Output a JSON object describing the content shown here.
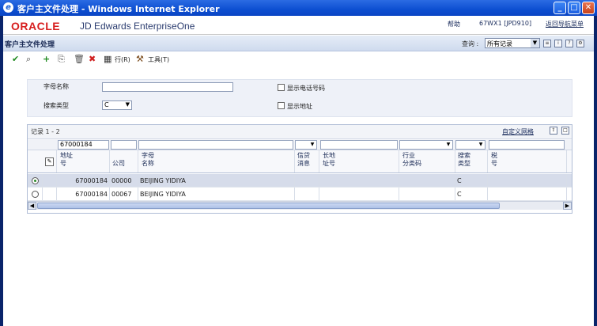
{
  "window": {
    "title": "客户主文件处理 - Windows Internet Explorer",
    "icon": "ie-icon",
    "controls": [
      "minimize-icon",
      "maximize-icon",
      "close-icon"
    ]
  },
  "header": {
    "logo": "ORACLE",
    "app_name": "JD Edwards EnterpriseOne",
    "help": "帮助",
    "environment": "67WX1 [JPD910]",
    "return_link": "返回导航菜单"
  },
  "form": {
    "title": "客户主文件处理",
    "query_label": "查询 :",
    "query_value": "所有记录",
    "icons": [
      "personalize-icon",
      "info-icon",
      "help-icon",
      "tools-icon"
    ]
  },
  "toolbar": {
    "select": "select-icon",
    "find": "find-icon",
    "add": "add-icon",
    "copy": "copy-icon",
    "delete": "delete-icon",
    "close": "close-icon",
    "row_label": "行(R)",
    "tools_label": "工具(T)"
  },
  "filters": {
    "alpha_name_label": "字母名称",
    "alpha_name_value": "",
    "search_type_label": "搜索类型",
    "search_type_value": "C",
    "show_phone_label": "显示电话号码",
    "show_phone_checked": false,
    "show_address_label": "显示地址",
    "show_address_checked": false
  },
  "grid": {
    "record_count": "记录 1 - 2",
    "customize_link": "自定义网格",
    "filter_values": {
      "address_number": "67000184"
    },
    "columns": [
      {
        "key": "address_number",
        "label_line1": "地址",
        "label_line2": "号"
      },
      {
        "key": "company",
        "label_line1": "",
        "label_line2": "公司"
      },
      {
        "key": "alpha_name",
        "label_line1": "字母",
        "label_line2": "名称"
      },
      {
        "key": "credit_message",
        "label_line1": "信贷",
        "label_line2": "消息"
      },
      {
        "key": "long_address",
        "label_line1": "长地",
        "label_line2": "址号"
      },
      {
        "key": "industry_class",
        "label_line1": "行业",
        "label_line2": "分类码"
      },
      {
        "key": "search_type",
        "label_line1": "搜索",
        "label_line2": "类型"
      },
      {
        "key": "tax_id",
        "label_line1": "税",
        "label_line2": "号"
      }
    ],
    "rows": [
      {
        "selected": true,
        "address_number": "67000184",
        "company": "00000",
        "alpha_name": "BEIJING YIDIYA",
        "credit_message": "",
        "long_address": "",
        "industry_class": "",
        "search_type": "C",
        "tax_id": ""
      },
      {
        "selected": false,
        "address_number": "67000184",
        "company": "00067",
        "alpha_name": "BEIJING YIDIYA",
        "credit_message": "",
        "long_address": "",
        "industry_class": "",
        "search_type": "C",
        "tax_id": ""
      }
    ]
  },
  "colors": {
    "title_bar": "#0d4fd1",
    "oracle_red": "#d71f1f",
    "selected_row": "#d6dcea",
    "form_header": "#cfdbee"
  }
}
